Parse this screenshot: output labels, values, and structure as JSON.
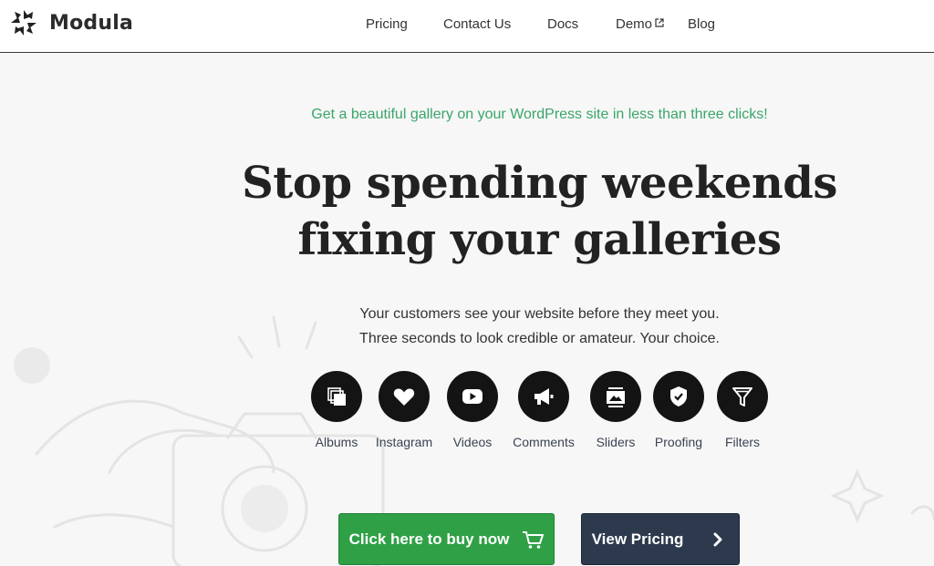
{
  "brand": {
    "name": "Modula",
    "icon": "modula-logo-icon"
  },
  "nav": {
    "items": [
      {
        "label": "Pricing"
      },
      {
        "label": "Contact Us"
      },
      {
        "label": "Docs"
      },
      {
        "label": "Demo",
        "icon": "external-link-icon"
      },
      {
        "label": "Blog"
      }
    ]
  },
  "hero": {
    "tagline": "Get a beautiful gallery on your WordPress site in less than three clicks!",
    "headline_line1": "Stop spending weekends",
    "headline_line2": "fixing your galleries",
    "sub_line1": "Your customers see your website before they meet you.",
    "sub_line2": "Three seconds to look credible or amateur. Your choice."
  },
  "features": [
    {
      "label": "Albums",
      "icon": "albums-icon"
    },
    {
      "label": "Instagram",
      "icon": "heart-icon"
    },
    {
      "label": "Videos",
      "icon": "video-play-icon"
    },
    {
      "label": "Comments",
      "icon": "megaphone-icon"
    },
    {
      "label": "Sliders",
      "icon": "slider-image-icon"
    },
    {
      "label": "Proofing",
      "icon": "shield-check-icon"
    },
    {
      "label": "Filters",
      "icon": "filter-funnel-icon"
    }
  ],
  "cta": {
    "buy_label": "Click here to buy now",
    "buy_icon": "cart-icon",
    "pricing_label": "View Pricing",
    "pricing_icon": "chevron-right-icon"
  },
  "colors": {
    "accent_green": "#3aa56a",
    "buy_button": "#2fa046",
    "pricing_button": "#2d3a4e",
    "icon_circle": "#141414"
  }
}
